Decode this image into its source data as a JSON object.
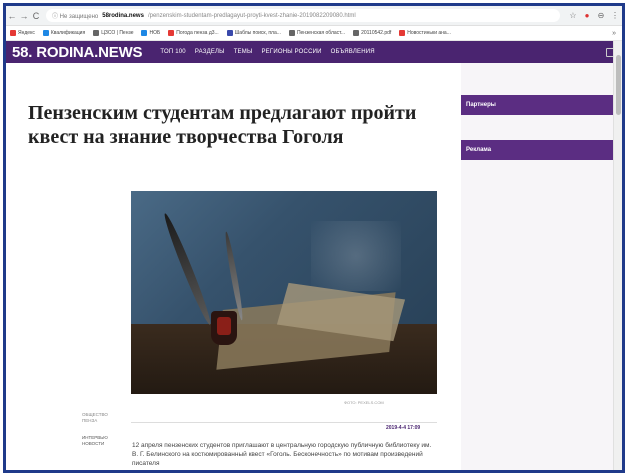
{
  "browser": {
    "back_label": "←",
    "forward_label": "→",
    "reload_label": "C",
    "url_security": "ⓘ Не защищено",
    "url_host": "58rodina.news",
    "url_path": "/penzenskim-studentam-predlagayut-proyti-kvest-zhanie-2019082209080.html",
    "star_icon": "☆",
    "ext_icon": "●",
    "profile_icon": "⊖",
    "menu_icon": "⋮"
  },
  "bookmarks": [
    {
      "label": "Яндекс",
      "color": "#e53935"
    },
    {
      "label": "Квалификация",
      "color": "#1e88e5"
    },
    {
      "label": "ЦЗСО | Пензе",
      "color": "#666666"
    },
    {
      "label": "НОБ",
      "color": "#1e88e5"
    },
    {
      "label": "Погода пенза д3...",
      "color": "#e53935"
    },
    {
      "label": "Шаблы поиск, пла...",
      "color": "#3949ab"
    },
    {
      "label": "Пензенская област...",
      "color": "#666666"
    },
    {
      "label": "20110542.pdf",
      "color": "#666666"
    },
    {
      "label": "Новостиньки ана...",
      "color": "#e53935"
    }
  ],
  "bookmarks_more": "»",
  "site": {
    "logo": "58. RODINA.NEWS",
    "menu": [
      "ТОП 100",
      "РАЗДЕЛЫ",
      "ТЕМЫ",
      "РЕГИОНЫ РОССИИ",
      "ОБЪЯВЛЕНИЯ"
    ]
  },
  "article": {
    "headline": "Пензенским студентам предлагают пройти квест на знание творчества Гоголя",
    "photo_credit": "ФОТО: PEXELS.COM",
    "meta_section": "ОБЩЕСТВО",
    "meta_sub": "ПЕНЗА",
    "meta_tag1": "ИНТЕРВЬЮ",
    "meta_tag2": "НОВОСТИ",
    "date": "2019-4-4 17:09",
    "lead": "12 апреля пензенских студентов приглашают в центральную городскую публичную библиотеку им. В. Г. Белинского на костюмированный квест «Гоголь. Бесконечность» по мотивам произведений писателя"
  },
  "sidebar": {
    "partners": "Партнеры",
    "ads": "Реклама"
  }
}
